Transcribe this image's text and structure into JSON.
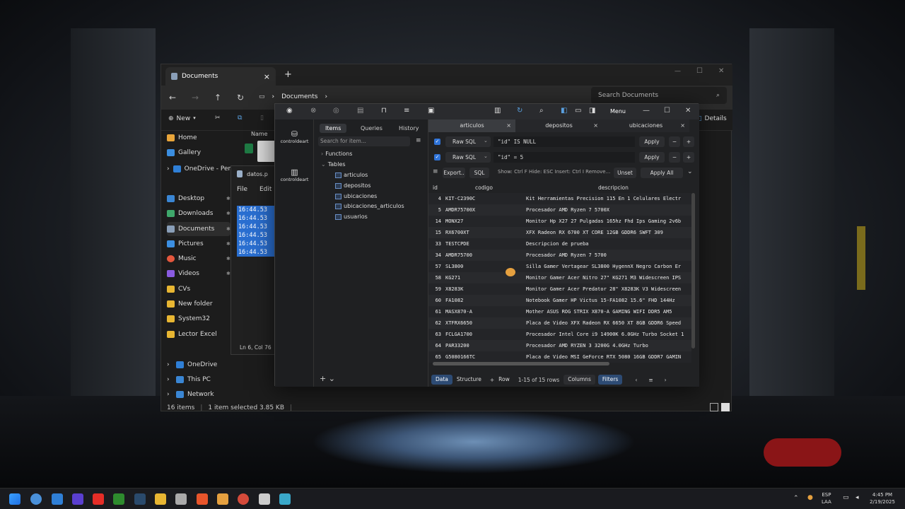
{
  "explorer": {
    "tab_title": "Documents",
    "new_tab": "+",
    "close": "×",
    "window_controls": [
      "—",
      "☐",
      "✕"
    ],
    "address": "Documents",
    "search_placeholder": "Search Documents",
    "new_label": "New",
    "details_label": "Details",
    "column_name": "Name",
    "sidebar": [
      {
        "label": "Home",
        "icon": "home-icon",
        "color": "#e9a53a"
      },
      {
        "label": "Gallery",
        "icon": "gallery-icon",
        "color": "#3b8ee0"
      },
      {
        "label": "OneDrive - Personal",
        "icon": "onedrive-icon",
        "color": "#2f7fd6"
      },
      {
        "label": "Desktop",
        "icon": "desktop-icon",
        "color": "#3a86d4"
      },
      {
        "label": "Downloads",
        "icon": "downloads-icon",
        "color": "#3fa86b"
      },
      {
        "label": "Documents",
        "icon": "documents-icon",
        "color": "#8a9fb8"
      },
      {
        "label": "Pictures",
        "icon": "pictures-icon",
        "color": "#3c8fe1"
      },
      {
        "label": "Music",
        "icon": "music-icon",
        "color": "#e4573d"
      },
      {
        "label": "Videos",
        "icon": "videos-icon",
        "color": "#8a5be0"
      },
      {
        "label": "CVs",
        "icon": "folder-icon",
        "color": "#e8b632"
      },
      {
        "label": "New folder",
        "icon": "folder-icon",
        "color": "#e8b632"
      },
      {
        "label": "System32",
        "icon": "folder-icon",
        "color": "#e8b632"
      },
      {
        "label": "Lector Excel",
        "icon": "folder-icon",
        "color": "#e8b632"
      },
      {
        "label": "OneDrive",
        "icon": "onedrive-icon",
        "color": "#2f7fd6"
      },
      {
        "label": "This PC",
        "icon": "pc-icon",
        "color": "#3a86d4"
      },
      {
        "label": "Network",
        "icon": "network-icon",
        "color": "#3a86d4"
      }
    ],
    "status_items": "16 items",
    "status_selected": "1 item selected  3.85 KB"
  },
  "editor": {
    "filename": "datos.p",
    "menu_file": "File",
    "menu_edit": "Edit",
    "lines": [
      "16:44.53",
      "16:44.53",
      "16:44.53",
      "16:44.53",
      "16:44.53",
      "16:44.53"
    ],
    "status": "Ln 6, Col 76"
  },
  "db": {
    "menu_label": "Menu",
    "connections": [
      "controldeart",
      "controldeart"
    ],
    "tree_tabs": [
      "Items",
      "Queries",
      "History"
    ],
    "tree_search_placeholder": "Search for item...",
    "tree": {
      "functions": "Functions",
      "tables": "Tables",
      "table_list": [
        "articulos",
        "depositos",
        "ubicaciones",
        "ubicaciones_articulos",
        "usuarios"
      ]
    },
    "tabs": [
      "articulos",
      "depositos",
      "ubicaciones"
    ],
    "filters": [
      {
        "mode": "Raw SQL",
        "expr": "\"id\" IS NULL",
        "apply": "Apply"
      },
      {
        "mode": "Raw SQL",
        "expr": "\"id\" = 5",
        "apply": "Apply"
      }
    ],
    "toolbar": {
      "export": "Export..",
      "sql": "SQL",
      "hint": "Show: Ctrl F Hide: ESC Insert: Ctrl I Remove...",
      "unset": "Unset",
      "apply_all": "Apply All"
    },
    "columns": [
      "id",
      "codigo",
      "descripcion"
    ],
    "rows": [
      {
        "id": "4",
        "codigo": "KIT-C2390C",
        "descripcion": "Kit Herramientas Precision 115 En 1 Celulares Electr"
      },
      {
        "id": "5",
        "codigo": "AMDR75700X",
        "descripcion": "Procesador AMD Ryzen 7 5700X"
      },
      {
        "id": "14",
        "codigo": "MONX27",
        "descripcion": "Monitor Hp X27 27 Pulgadas 165hz Fhd Ips Gaming 2v6b"
      },
      {
        "id": "15",
        "codigo": "RX6700XT",
        "descripcion": "XFX Radeon RX 6700 XT CORE 12GB GDDR6 SWFT 309"
      },
      {
        "id": "33",
        "codigo": "TESTCPDE",
        "descripcion": "Descripcion de prueba"
      },
      {
        "id": "34",
        "codigo": "AMDR75700",
        "descripcion": "Procesador AMD Ryzen 7 5700"
      },
      {
        "id": "57",
        "codigo": "SL3800",
        "descripcion": "Silla Gamer Vertagear SL3800 HygennX Negro Carbon Er"
      },
      {
        "id": "58",
        "codigo": "KG271",
        "descripcion": "Monitor Gamer Acer Nitro 27\" KG271 M3 Widescreen IPS"
      },
      {
        "id": "59",
        "codigo": "X8283K",
        "descripcion": "Monitor Gamer Acer Predator 28\" X8283K V3 Widescreen"
      },
      {
        "id": "60",
        "codigo": "FA1082",
        "descripcion": "Notebook Gamer HP Victus 15-FA1082 15.6\" FHD 144Hz"
      },
      {
        "id": "61",
        "codigo": "MASX870-A",
        "descripcion": "Mother ASUS ROG STRIX X870-A GAMING WIFI DDR5 AM5"
      },
      {
        "id": "62",
        "codigo": "XTFRX6650",
        "descripcion": "Placa de Video XFX Radeon RX 6650 XT 8GB GDDR6 Speed"
      },
      {
        "id": "63",
        "codigo": "FCLGA1700",
        "descripcion": "Procesador Intel Core i9 14900K 6.0GHz Turbo Socket 1"
      },
      {
        "id": "64",
        "codigo": "PAR33200",
        "descripcion": "Procesador AMD RYZEN 3 3200G 4.0GHz Turbo"
      },
      {
        "id": "65",
        "codigo": "G5080166TC",
        "descripcion": "Placa de Video MSI GeForce RTX 5080 16GB GDDR7 GAMIN"
      }
    ],
    "bottom": {
      "data": "Data",
      "structure": "Structure",
      "row": "Row",
      "range": "1-15 of 15 rows",
      "columns": "Columns",
      "filters": "Filters"
    }
  },
  "taskbar": {
    "lang_top": "ESP",
    "lang_bottom": "LAA",
    "time": "4:45 PM",
    "date": "2/19/2025"
  }
}
